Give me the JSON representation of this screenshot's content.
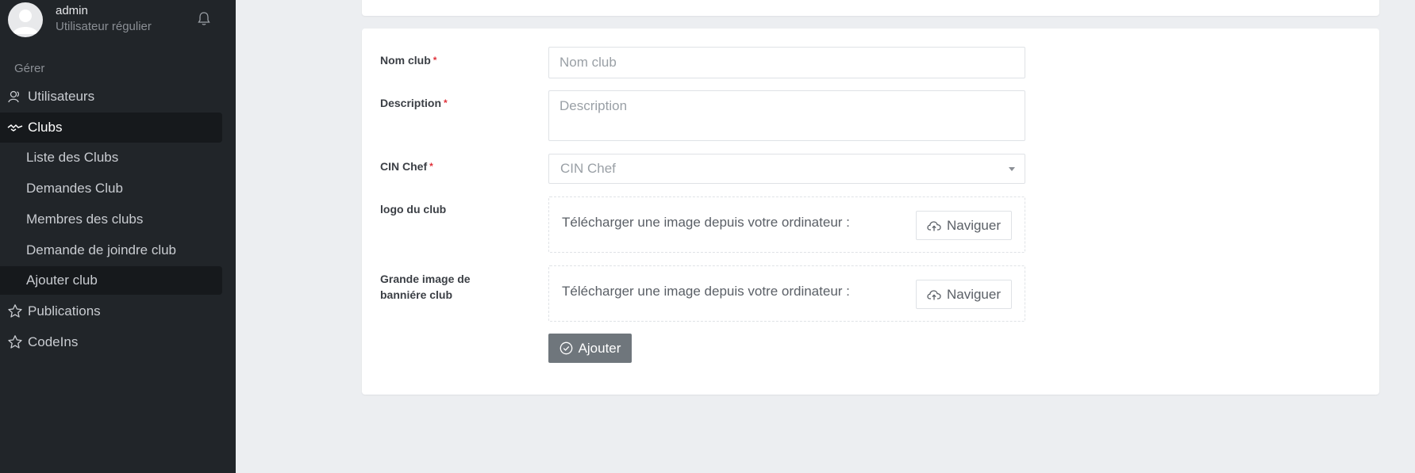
{
  "user": {
    "name": "admin",
    "role": "Utilisateur régulier"
  },
  "sidebar": {
    "section_label": "Gérer",
    "items": [
      {
        "label": "Utilisateurs",
        "icon": "users-icon"
      },
      {
        "label": "Clubs",
        "icon": "clubs-icon",
        "active": true
      },
      {
        "label": "Publications",
        "icon": "star-icon"
      },
      {
        "label": "CodeIns",
        "icon": "star-icon"
      }
    ],
    "sub_items": [
      {
        "label": "Liste des Clubs"
      },
      {
        "label": "Demandes Club"
      },
      {
        "label": "Membres des clubs"
      },
      {
        "label": "Demande de joindre club"
      },
      {
        "label": "Ajouter club",
        "active": true
      }
    ]
  },
  "form": {
    "nom_club": {
      "label": "Nom club",
      "required": "*",
      "placeholder": "Nom club",
      "value": ""
    },
    "description": {
      "label": "Description",
      "required": "*",
      "placeholder": "Description",
      "value": ""
    },
    "cin_chef": {
      "label": "CIN Chef",
      "required": "*",
      "selected": "CIN Chef"
    },
    "logo": {
      "label": "logo du club",
      "text": "Télécharger une image depuis votre ordinateur :",
      "button": "Naviguer"
    },
    "banner": {
      "label_line1": "Grande image de",
      "label_line2": "banniére club",
      "text": "Télécharger une image depuis votre ordinateur :",
      "button": "Naviguer"
    },
    "submit": "Ajouter"
  },
  "colors": {
    "sidebar_bg": "#212529",
    "active_bg": "#16191c",
    "page_bg": "#eceef1",
    "required": "#e0323b",
    "submit_bg": "#6f767c"
  }
}
